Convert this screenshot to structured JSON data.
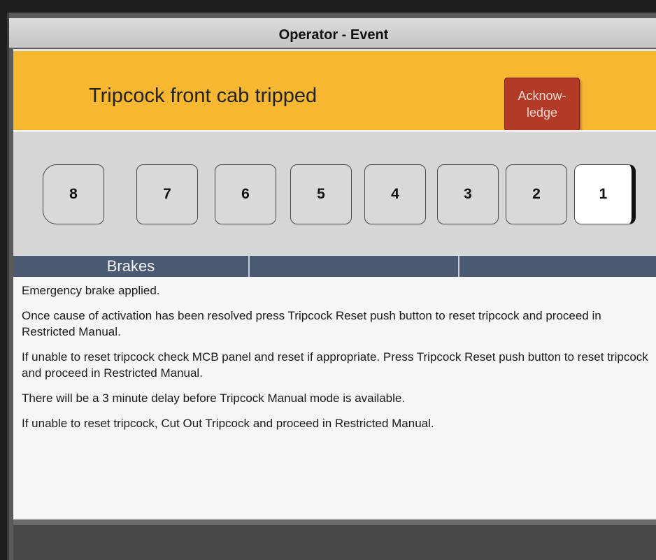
{
  "window": {
    "title": "Operator - Event"
  },
  "alert": {
    "message": "Tripcock front cab tripped",
    "acknowledge_label": "Acknow-\nledge",
    "color": "#f7b731",
    "button_color": "#b33a26"
  },
  "cars": [
    {
      "label": "8",
      "active": false
    },
    {
      "label": "7",
      "active": false
    },
    {
      "label": "6",
      "active": false
    },
    {
      "label": "5",
      "active": false
    },
    {
      "label": "4",
      "active": false
    },
    {
      "label": "3",
      "active": false
    },
    {
      "label": "2",
      "active": false
    },
    {
      "label": "1",
      "active": true
    }
  ],
  "tabs": [
    {
      "label": "Brakes"
    },
    {
      "label": ""
    },
    {
      "label": ""
    }
  ],
  "instructions": [
    "Emergency brake applied.",
    "Once cause of activation has been resolved press Tripcock Reset push button to reset tripcock and proceed in Restricted Manual.",
    "If unable to reset tripcock check MCB panel and reset if appropriate. Press Tripcock Reset push button to reset tripcock and proceed in Restricted Manual.",
    "There will be a 3 minute delay before Tripcock Manual mode is available.",
    "If unable to reset tripcock, Cut Out Tripcock and proceed in Restricted Manual."
  ]
}
